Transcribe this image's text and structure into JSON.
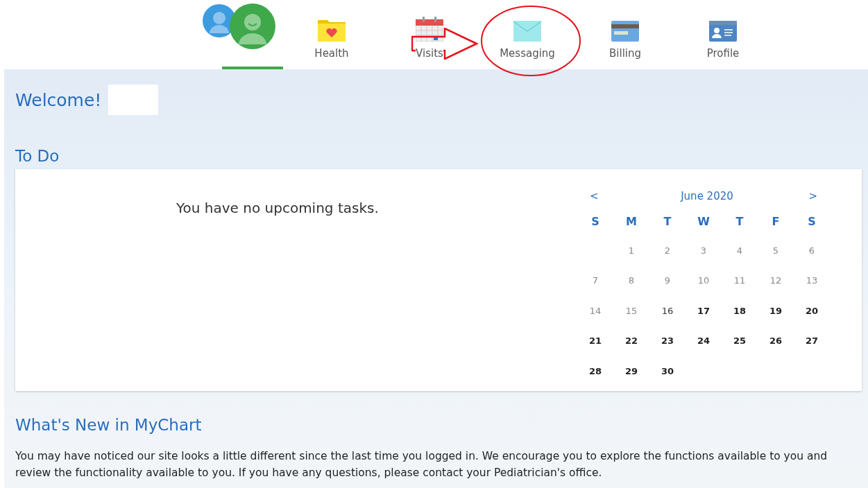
{
  "nav": {
    "tabs": [
      {
        "kind": "avatars",
        "selected": true
      },
      {
        "kind": "health",
        "label": "Health",
        "selected": false
      },
      {
        "kind": "visits",
        "label": "Visits",
        "selected": false
      },
      {
        "kind": "messaging",
        "label": "Messaging",
        "selected": false
      },
      {
        "kind": "billing",
        "label": "Billing",
        "selected": false
      },
      {
        "kind": "profile",
        "label": "Profile",
        "selected": false
      }
    ]
  },
  "annotations": [
    {
      "kind": "arrow"
    },
    {
      "kind": "ellipse"
    }
  ],
  "welcome": {
    "title": "Welcome!",
    "name_redacted": true
  },
  "todo": {
    "title": "To Do",
    "message": "You have no upcoming tasks.",
    "calendar": {
      "prev": "<",
      "month": "June 2020",
      "next": ">",
      "weekdays": [
        "S",
        "M",
        "T",
        "W",
        "T",
        "F",
        "S"
      ],
      "weeks": [
        {
          "starts_midweek": true,
          "days": [
            {
              "day": "1",
              "kind": "past"
            },
            {
              "day": "2",
              "kind": "past"
            },
            {
              "day": "3",
              "kind": "past"
            },
            {
              "day": "4",
              "kind": "past"
            },
            {
              "day": "5",
              "kind": "past"
            },
            {
              "day": "6",
              "kind": "past"
            }
          ]
        },
        {
          "days": [
            {
              "day": "7",
              "kind": "past"
            },
            {
              "day": "8",
              "kind": "past"
            },
            {
              "day": "9",
              "kind": "past"
            },
            {
              "day": "10",
              "kind": "past"
            },
            {
              "day": "11",
              "kind": "past"
            },
            {
              "day": "12",
              "kind": "past"
            },
            {
              "day": "13",
              "kind": "past"
            }
          ]
        },
        {
          "days": [
            {
              "day": "14",
              "kind": "past"
            },
            {
              "day": "15",
              "kind": "past"
            },
            {
              "day": "16",
              "kind": "today"
            },
            {
              "day": "17",
              "kind": "future"
            },
            {
              "day": "18",
              "kind": "future"
            },
            {
              "day": "19",
              "kind": "future"
            },
            {
              "day": "20",
              "kind": "future"
            }
          ]
        },
        {
          "days": [
            {
              "day": "21",
              "kind": "future"
            },
            {
              "day": "22",
              "kind": "future"
            },
            {
              "day": "23",
              "kind": "future"
            },
            {
              "day": "24",
              "kind": "future"
            },
            {
              "day": "25",
              "kind": "future"
            },
            {
              "day": "26",
              "kind": "future"
            },
            {
              "day": "27",
              "kind": "future"
            }
          ]
        },
        {
          "days": [
            {
              "day": "28",
              "kind": "future"
            },
            {
              "day": "29",
              "kind": "future"
            },
            {
              "day": "30",
              "kind": "future"
            }
          ]
        }
      ]
    }
  },
  "whats_new": {
    "title": "What's New in MyChart",
    "text": "You may have noticed our site looks a little different since the last time you logged in. We encourage you to explore the functions available to you and review the functionality available to you. If you have any questions, please contact your Pediatrician's office."
  }
}
